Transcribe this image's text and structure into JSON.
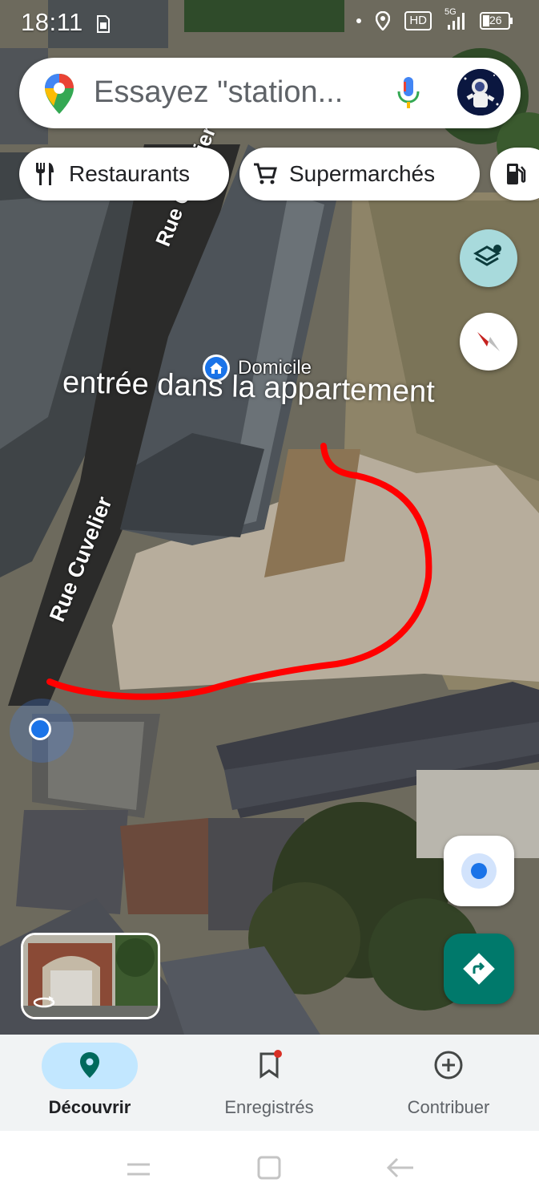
{
  "status_bar": {
    "time": "18:11",
    "network": "5G",
    "hd": "HD",
    "battery": "26"
  },
  "search": {
    "placeholder": "Essayez \"station...",
    "logo_icon": "google-maps-pin-icon",
    "mic_icon": "microphone-icon",
    "avatar_icon": "astronaut-avatar"
  },
  "chips": [
    {
      "label": "Restaurants",
      "icon": "fork-knife-icon"
    },
    {
      "label": "Supermarchés",
      "icon": "shopping-cart-icon"
    },
    {
      "label": "",
      "icon": "gas-station-icon"
    }
  ],
  "map": {
    "street_label_top": "Rue Cuvelier",
    "street_label_bottom": "Rue Cuvelier",
    "home_label": "Domicile",
    "annotation": "entrée dans la appartement",
    "annotation_color": "#ff0000"
  },
  "bottom_nav": {
    "items": [
      {
        "label": "Découvrir",
        "icon": "location-pin-icon",
        "active": true
      },
      {
        "label": "Enregistrés",
        "icon": "bookmark-icon",
        "active": false
      },
      {
        "label": "Contribuer",
        "icon": "add-circle-icon",
        "active": false
      }
    ]
  },
  "colors": {
    "accent_teal": "#00796b",
    "active_pill": "#c2e7ff",
    "route_red": "#ff0000"
  }
}
